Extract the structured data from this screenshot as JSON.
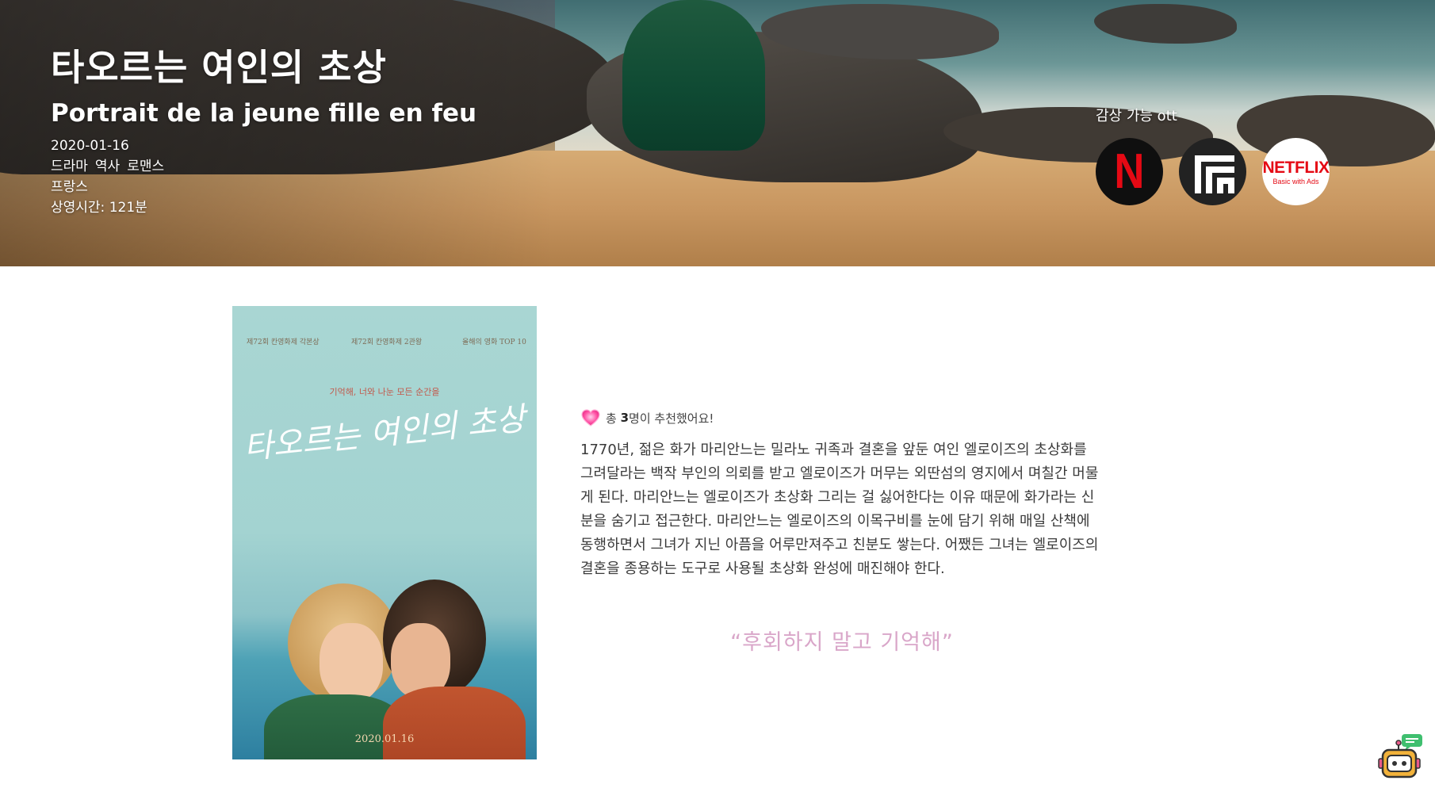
{
  "movie": {
    "title_ko": "타오르는 여인의 초상",
    "title_original": "Portrait de la jeune fille en feu",
    "release_date": "2020-01-16",
    "genres": [
      "드라마",
      "역사",
      "로맨스"
    ],
    "country": "프랑스",
    "runtime": "상영시간: 121분"
  },
  "ott": {
    "label": "감상 가능 ott",
    "services": [
      {
        "name": "netflix-icon",
        "text": "N",
        "color": "#e50914"
      },
      {
        "name": "laftel-icon",
        "text": "",
        "color": "#222222"
      },
      {
        "name": "netflix-basic-with-ads-icon",
        "text": "NETFLIX",
        "subtext": "Basic with Ads",
        "color": "#e50914"
      }
    ]
  },
  "poster": {
    "laurel_left": "제72회 칸영화제 각본상",
    "laurel_center": "제72회 칸영화제 2관왕",
    "laurel_right": "올해의 영화 TOP 10",
    "tagline": "기억해, 너와 나눈 모든 순간을",
    "title": "타오르는 여인의 초상",
    "date": "2020.01.16"
  },
  "recommend": {
    "prefix": "총",
    "count": "3",
    "suffix": "명이 추천했어요!"
  },
  "synopsis": "1770년, 젊은 화가 마리안느는 밀라노 귀족과 결혼을 앞둔 여인 엘로이즈의 초상화를 그려달라는 백작 부인의 의뢰를 받고 엘로이즈가 머무는 외딴섬의 영지에서 며칠간 머물게 된다. 마리안느는 엘로이즈가 초상화 그리는 걸 싫어한다는 이유 때문에 화가라는 신분을 숨기고 접근한다. 마리안느는 엘로이즈의 이목구비를 눈에 담기 위해 매일 산책에 동행하면서 그녀가 지닌 아픔을 어루만져주고 친분도 쌓는다. 어쨌든 그녀는 엘로이즈의 결혼을 종용하는 도구로 사용될 초상화 완성에 매진해야 한다.",
  "quote": "“후회하지 말고 기억해”",
  "colors": {
    "quote": "#d9a6c9",
    "heart": "#ff4fa3",
    "netflix_red": "#e50914"
  }
}
